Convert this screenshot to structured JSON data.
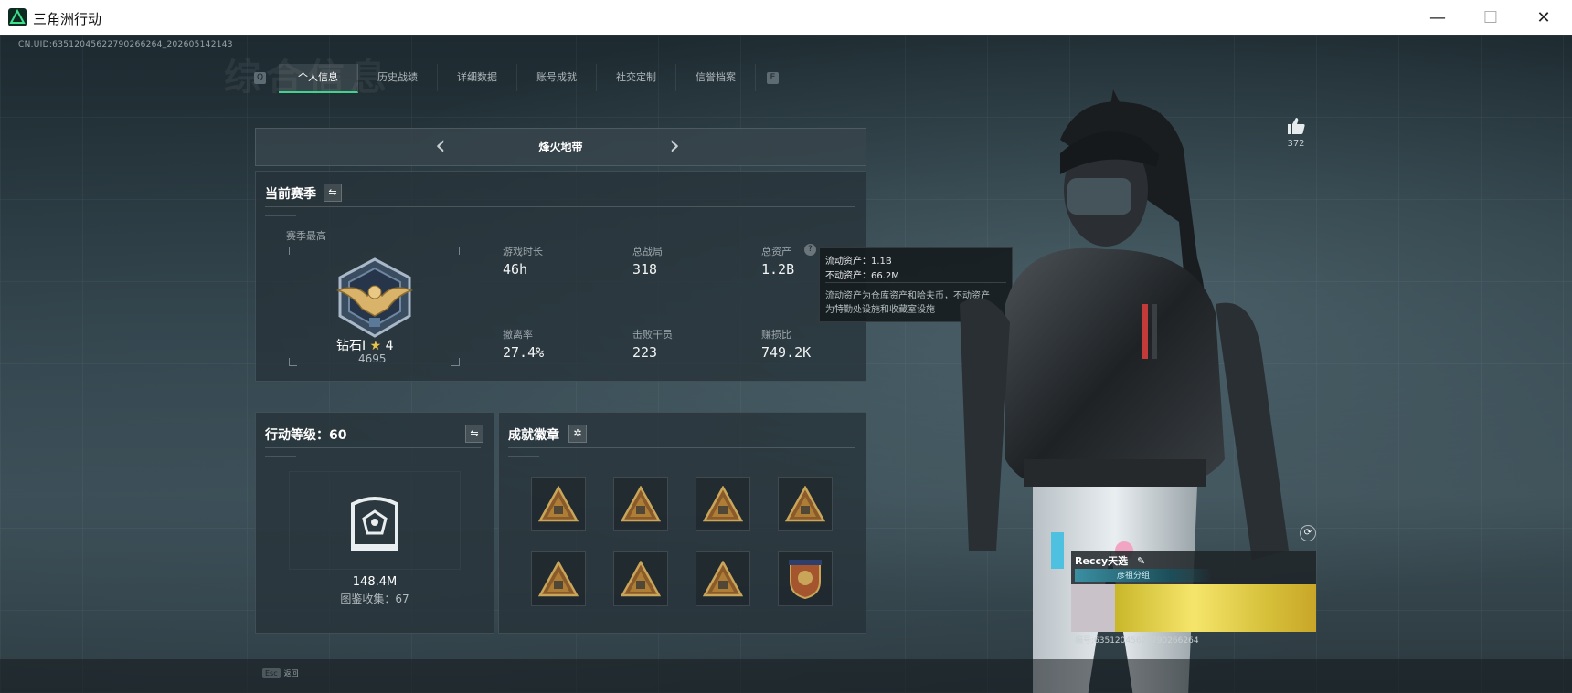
{
  "window": {
    "title": "三角洲行动",
    "minimize": "—",
    "maximize": "☐",
    "close": "✕"
  },
  "header": {
    "uid": "CN.UID:63512045622790266264_202605142143",
    "bg_title": "综合信息"
  },
  "tabs": {
    "left_key": "Q",
    "right_key": "E",
    "items": [
      {
        "label": "个人信息",
        "active": true
      },
      {
        "label": "历史战绩",
        "active": false
      },
      {
        "label": "详细数据",
        "active": false
      },
      {
        "label": "账号成就",
        "active": false
      },
      {
        "label": "社交定制",
        "active": false
      },
      {
        "label": "信誉档案",
        "active": false
      }
    ]
  },
  "mode": {
    "title": "烽火地带",
    "prev": "‹",
    "next": "›"
  },
  "season": {
    "title": "当前赛季",
    "switch_icon": "⇋",
    "best_label": "赛季最高",
    "rank": "钻石I",
    "stars": "4",
    "score": "4695",
    "help_icon": "?",
    "stats": [
      {
        "label": "游戏时长",
        "value": "46h"
      },
      {
        "label": "总战局",
        "value": "318"
      },
      {
        "label": "总资产",
        "value": "1.2B"
      },
      {
        "label": "撤离率",
        "value": "27.4%"
      },
      {
        "label": "击败干员",
        "value": "223"
      },
      {
        "label": "赚损比",
        "value": "749.2K"
      }
    ]
  },
  "tooltip": {
    "line1": "流动资产：1.1B",
    "line2": "不动资产：66.2M",
    "desc1": "流动资产为仓库资产和哈夫币，不动资产",
    "desc2": "为特勤处设施和收藏室设施"
  },
  "level": {
    "title": "行动等级：60",
    "switch_icon": "⇋",
    "value": "148.4M",
    "collection": "图鉴收集：67"
  },
  "badges": {
    "title": "成就徽章",
    "gear_icon": "✲",
    "count": 8,
    "colors": [
      "#c9a55a",
      "#b98b3c",
      "#8a5a2a",
      "#2a3038"
    ]
  },
  "social": {
    "likes": "372",
    "like_icon": "thumbs-up-icon",
    "refresh_icon": "⟳"
  },
  "profile_card": {
    "name": "Reccy天选",
    "edit_icon": "✎",
    "team": "彦祖分组",
    "id_label": "编号:63512045622790266264"
  },
  "footer": {
    "esc_key": "Esc",
    "esc_label": "返回"
  }
}
